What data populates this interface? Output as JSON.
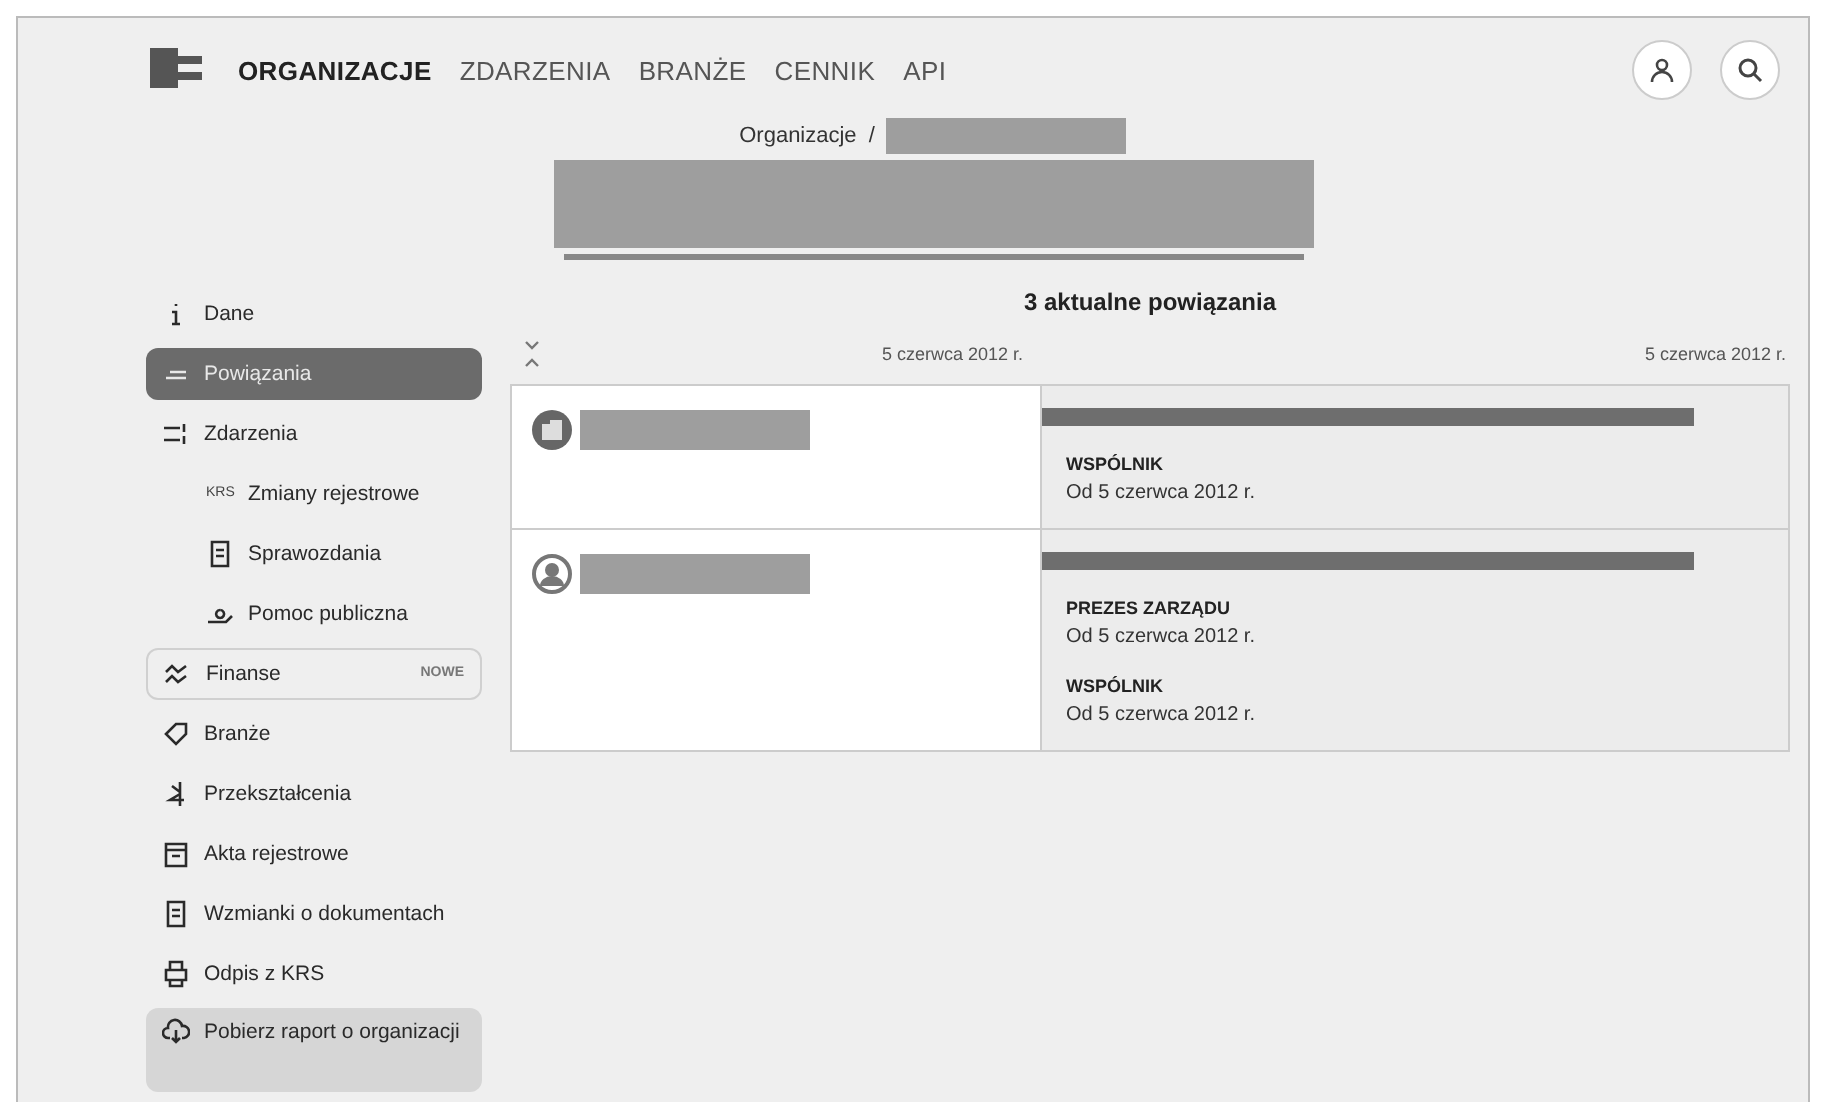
{
  "nav": [
    {
      "label": "ORGANIZACJE",
      "selected": true
    },
    {
      "label": "ZDARZENIA",
      "selected": false
    },
    {
      "label": "BRANŻE",
      "selected": false
    },
    {
      "label": "CENNIK",
      "selected": false
    },
    {
      "label": "API",
      "selected": false
    }
  ],
  "breadcrumb": {
    "root": "Organizacje",
    "separator": "/"
  },
  "sidebar": [
    {
      "kind": "item",
      "label": "Dane",
      "selected": false
    },
    {
      "kind": "item",
      "label": "Powiązania",
      "selected": true
    },
    {
      "kind": "item",
      "label": "Zdarzenia",
      "selected": false
    },
    {
      "kind": "sub",
      "icon_text": "KRS",
      "label": "Zmiany rejestrowe",
      "selected": false
    },
    {
      "kind": "sub",
      "label": "Sprawozdania",
      "selected": false
    },
    {
      "kind": "sub",
      "label": "Pomoc publiczna",
      "selected": false
    },
    {
      "kind": "badge",
      "label": "Finanse",
      "badge": "NOWE",
      "selected": false
    },
    {
      "kind": "item",
      "label": "Branże",
      "selected": false
    },
    {
      "kind": "item",
      "label": "Przekształcenia",
      "selected": false
    },
    {
      "kind": "item",
      "label": "Akta rejestrowe",
      "selected": false
    },
    {
      "kind": "item",
      "label": "Wzmianki o dokumentach",
      "selected": false
    },
    {
      "kind": "item",
      "label": "Odpis z KRS",
      "selected": false
    },
    {
      "kind": "download",
      "label": "Pobierz raport o organizacji",
      "selected": false
    }
  ],
  "relations_title": "3 aktualne powiązania",
  "timeline": {
    "start": "5 czerwca 2012 r.",
    "end": "5 czerwca 2012 r."
  },
  "relations": [
    {
      "kind": "company",
      "roles": [
        {
          "role": "WSPÓLNIK",
          "since": "Od 5 czerwca 2012 r."
        }
      ]
    },
    {
      "kind": "person",
      "roles": [
        {
          "role": "PREZES ZARZĄDU",
          "since": "Od 5 czerwca 2012 r."
        },
        {
          "role": "WSPÓLNIK",
          "since": "Od 5 czerwca 2012 r."
        }
      ]
    }
  ]
}
